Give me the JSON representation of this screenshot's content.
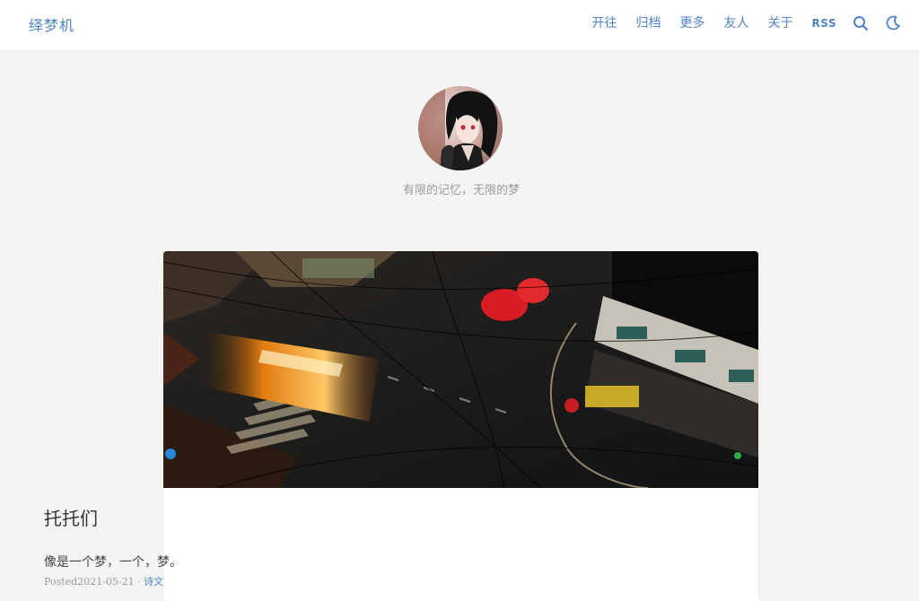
{
  "header": {
    "brand": "绎梦机",
    "nav": [
      {
        "label": "开往"
      },
      {
        "label": "归档"
      },
      {
        "label": "更多"
      },
      {
        "label": "友人"
      },
      {
        "label": "关于"
      },
      {
        "label": "RSS"
      }
    ],
    "icons": [
      "search-icon",
      "moon-icon"
    ]
  },
  "hero": {
    "tagline": "有限的记忆，无限的梦"
  },
  "post": {
    "title": "托托们",
    "excerpt": "像是一个梦，一个，梦。",
    "posted_prefix": "Posted",
    "date": "2021-05-21",
    "separator": "·",
    "category": "诗文"
  },
  "colors": {
    "accent": "#4f84c6",
    "background": "#f4f4f4",
    "card": "#ffffff"
  }
}
